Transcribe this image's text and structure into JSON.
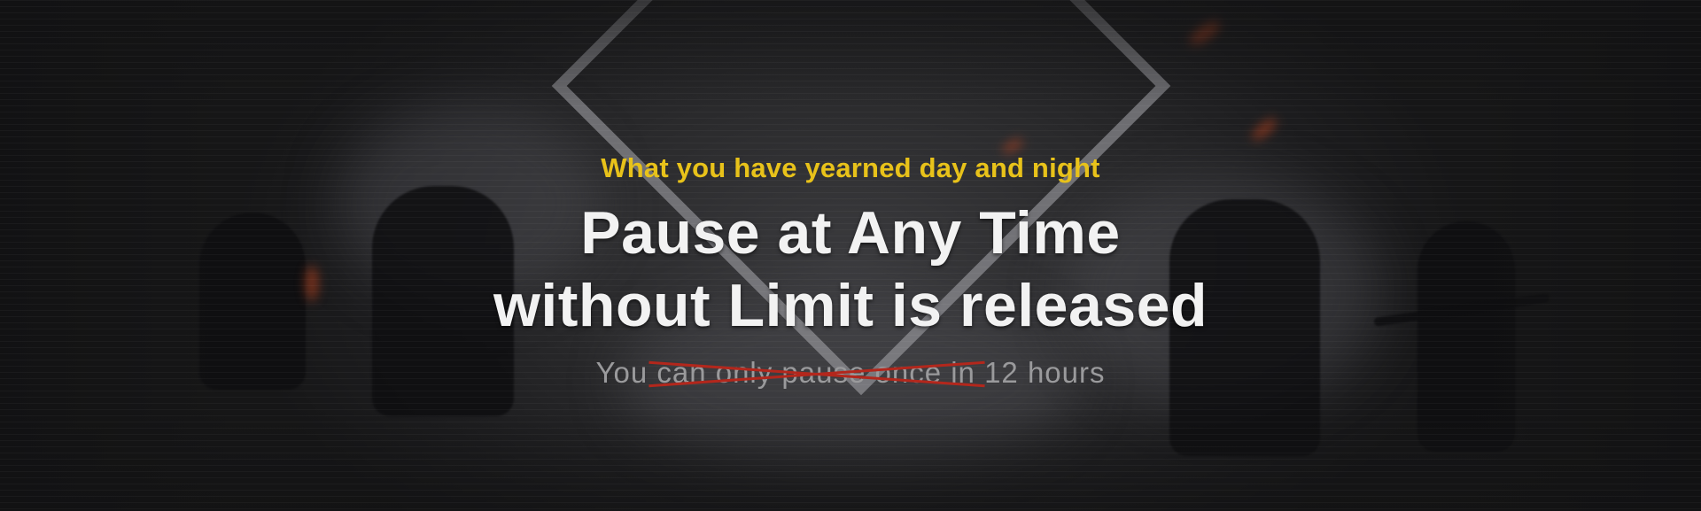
{
  "banner": {
    "tagline": "What you have yearned day and night",
    "headline_line1": "Pause at Any Time",
    "headline_line2": "without Limit is released",
    "subline": "You can only pause once in 12 hours"
  },
  "colors": {
    "background": "#1b1b1d",
    "tagline": "#e8c21a",
    "headline": "#f2f2f2",
    "subline": "#9a9a9c",
    "strike": "#b3271c",
    "diamond_frame": "#aaaaaf"
  }
}
